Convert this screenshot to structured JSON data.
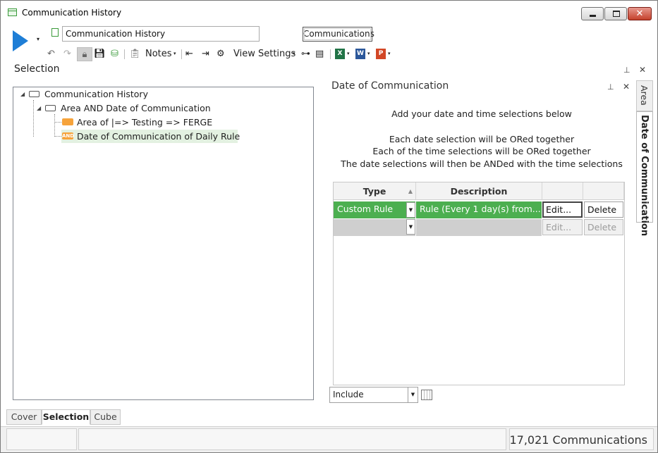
{
  "window": {
    "title": "Communication History",
    "controls": {
      "minimize": "—",
      "maximize": "□",
      "close": "✕"
    }
  },
  "toolbar": {
    "selection_name": "Communication History",
    "communications_button": "Communications",
    "notes_label": "Notes",
    "view_settings_label": "View Settings",
    "dropdown_caret": "▾",
    "icons": [
      "run-icon",
      "undo-icon",
      "redo-icon",
      "lock-icon",
      "save-icon",
      "database-icon",
      "clipboard-icon",
      "indent-icon",
      "outdent-icon",
      "settings-icon",
      "tree-icon",
      "grid-icon",
      "excel-icon",
      "word-icon",
      "powerpoint-icon"
    ],
    "excel_glyph": "X",
    "word_glyph": "W",
    "ppt_glyph": "P"
  },
  "selection_panel": {
    "title": "Selection",
    "tree": [
      {
        "label": "Communication History",
        "level": 0,
        "icon": "group-icon"
      },
      {
        "label": "Area AND Date of Communication",
        "level": 1,
        "icon": "group-icon"
      },
      {
        "label": "Area of |=> Testing => FERGE",
        "level": 2,
        "icon": "rule-icon"
      },
      {
        "label": "Date of Communication of Daily Rule",
        "level": 2,
        "icon": "and-icon",
        "selected": true,
        "icon_text": "AND"
      }
    ]
  },
  "date_panel": {
    "title": "Date of Communication",
    "intro": "Add your date and time selections below",
    "notes": [
      "Each date selection will be ORed together",
      "Each of the time selections will be ORed together",
      "The date selections will then be ANDed with the time selections"
    ],
    "grid": {
      "headers": {
        "type": "Type",
        "description": "Description",
        "edit": "",
        "delete": ""
      },
      "rows": [
        {
          "type": "Custom Rule",
          "description": "Rule (Every 1 day(s) from...",
          "edit": "Edit...",
          "delete": "Delete",
          "state": "active"
        },
        {
          "type": "",
          "description": "",
          "edit": "Edit...",
          "delete": "Delete",
          "state": "disabled"
        }
      ]
    },
    "include_select": "Include"
  },
  "side_tabs": [
    {
      "label": "Area",
      "active": false
    },
    {
      "label": "Date of Communication",
      "active": true
    }
  ],
  "bottom_tabs": [
    {
      "label": "Cover",
      "active": false
    },
    {
      "label": "Selection",
      "active": true
    },
    {
      "label": "Cube",
      "active": false
    }
  ],
  "status": {
    "count_text": "17,021 Communications"
  },
  "colors": {
    "accent_green": "#4caf50",
    "run_blue": "#1e7ed6",
    "rule_orange": "#f6a33b",
    "selected_row": "#e3f1e1"
  }
}
